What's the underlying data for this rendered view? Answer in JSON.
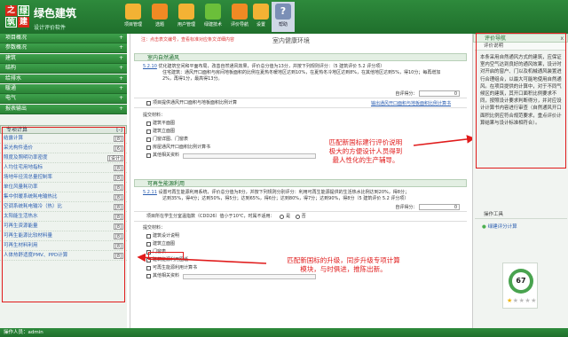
{
  "app": {
    "logo_chars": [
      "之",
      "绿",
      "筑",
      "建"
    ],
    "name": "绿色建筑",
    "subtitle": "设计评价软件"
  },
  "toolbar": {
    "items": [
      {
        "label": "项目管理",
        "icon": "folder-icon",
        "color": "#f3b234"
      },
      {
        "label": "选题",
        "icon": "chart-icon",
        "color": "#f08a24"
      },
      {
        "label": "用户管理",
        "icon": "users-icon",
        "color": "#f3b234"
      },
      {
        "label": "绿建技术",
        "icon": "leaf-icon",
        "color": "#6bbf3a"
      },
      {
        "label": "评价导航",
        "icon": "compass-icon",
        "color": "#f08a24"
      },
      {
        "label": "设置",
        "icon": "gear-icon",
        "color": "#f3b234"
      },
      {
        "label": "帮助",
        "icon": "help-icon",
        "color": "#7b8fb6",
        "glyph": "?"
      }
    ]
  },
  "sidebar": {
    "nav": [
      "项目概况",
      "参数概况",
      "建筑",
      "结构",
      "给排水",
      "暖通",
      "电气",
      "报表输出"
    ],
    "plus": "+",
    "expanded_title": "专项计算",
    "expanded_sign": "[-]",
    "subitems": [
      {
        "label": "结露计算",
        "tag": "[8]"
      },
      {
        "label": "采光构件造价",
        "tag": "[6]"
      },
      {
        "label": "照度及照明功率密度",
        "tag": "[设计]"
      },
      {
        "label": "人均住宅用地指标",
        "tag": "[8]"
      },
      {
        "label": "场地年径流总量控制率",
        "tag": "[8]"
      },
      {
        "label": "单位风量耗功率",
        "tag": "[8]"
      },
      {
        "label": "集中供暖系统耗电输热比",
        "tag": "[8]"
      },
      {
        "label": "空调系统耗电输冷（热）比",
        "tag": "[8]"
      },
      {
        "label": "太阳能生活热水",
        "tag": "[8]"
      },
      {
        "label": "可再生资源能量",
        "tag": "[8]"
      },
      {
        "label": "可再生能源比较材料量",
        "tag": "[8]"
      },
      {
        "label": "可再生材料利用",
        "tag": "[8]"
      },
      {
        "label": "人体热舒适度PMV、PPD计算",
        "tag": "[8]"
      }
    ]
  },
  "main": {
    "hint": "注：点击表文编号，查看标准对应条文详细内容",
    "title": "室内健康环境",
    "section1": {
      "head": "室内自然通风",
      "clause1_num": "5.2.10",
      "clause1_lines": [
        "优化建筑空间和平面布局，改善自然通风效果，评价总分值为13分，并按下列规则评分：（5 建筑评价 5.2 评分项）",
        "住宅建筑：通风开口面积与房间地板面积的比例在夏热冬暖地区达到10%，在夏热冬冷地区达到8%，在其他地区达到5%，得10分；每再增加",
        "2%，再得1分，最高得13分。"
      ],
      "self_score_label": "自评得分：",
      "self_score_value": "0",
      "project_check": "项目提供通风开口面积与地板面积比例计算",
      "link": "输出通风开口面积与地板面积比例计算书",
      "submit_title": "提交材料：",
      "checklist": [
        "建筑平面图",
        "建筑立面图",
        "门窗详图、门窗表",
        "房屋通风开口面积比例计算书",
        "其他相关资料"
      ]
    },
    "section2": {
      "head": "可再生能源利用",
      "clause_num": "5.2.11",
      "clause_lines": [
        "设置可再生能源利用系统，评价总分值为8分，并按下列规则分别评分：利用可再生能源提供的生活热水比例达到20%，得8分；",
        "达到35%，得4分；达到50%，得5分；达到65%，得6分；达到80%，得7分；达到90%，得8分（5 建筑评价 5.2 评分项）"
      ],
      "project_line": "项目所在学生分室温指数（CDD26）值小于10℃，时属不适用：",
      "radio_yes": "是",
      "radio_no": "否",
      "self_score_label": "自评得分：",
      "self_score_value": "0",
      "submit_title": "提交材料：",
      "checklist": [
        "建筑设计说明",
        "建筑立面图",
        "门窗表",
        "建筑能源利用图纸",
        "可再生能源利用计算书",
        "其他相关资料"
      ]
    },
    "annotation_top": [
      "匹配新国标建行评价说明",
      "极大的方便设计人员得到",
      "最人性化的生产辅导。"
    ],
    "annotation_bottom": [
      "匹配新国标的升级，同步升级专项计算",
      "模块，与时俱进，推陈出新。"
    ]
  },
  "rightpanel": {
    "head": "评价导航",
    "close": "x",
    "sub": "评价说明",
    "body": "本条采用自然通风方式的建筑，应保证室内空气达到良好的通风效果，设计时对开启的窗户、门以及机械通风装置进行合理组合，以最大可能地使用自然通风。在项目提供的计算中，对于不同气候区的建筑，其开口面积比例要求不同，按照设计要求判断得分，并对应设计计算书内容进行审查（自然通风开口面积比例应符合规范要求，重点评价计算结果与设计标准相符合）。",
    "tool_section": "操作工具",
    "tool_link": "绿建评分计算",
    "score": "67",
    "stars_total": 5,
    "stars_on": 1
  },
  "statusbar": {
    "text": "操作人员：admin"
  }
}
